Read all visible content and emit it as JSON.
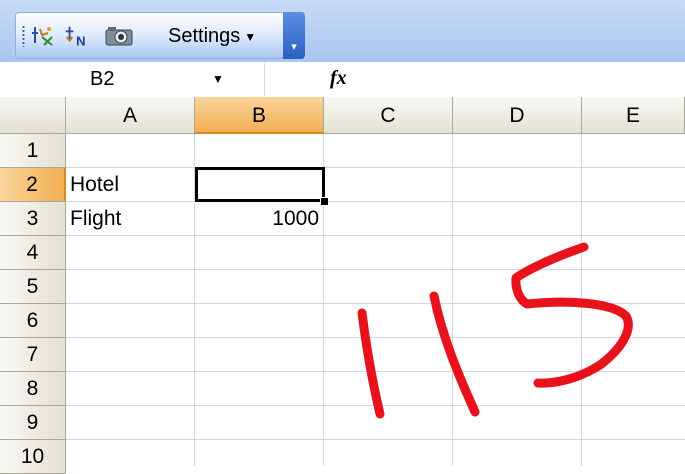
{
  "toolbar": {
    "icons": [
      "insert-function-sparkle-icon",
      "sort-n-icon",
      "camera-icon"
    ],
    "settings_label": "Settings",
    "settings_arrow": "▼",
    "overflow_glyph": "▾"
  },
  "formula_bar": {
    "name_box_value": "B2",
    "name_box_arrow": "▼",
    "fx_label": "fx",
    "formula_value": ""
  },
  "columns": [
    "A",
    "B",
    "C",
    "D",
    "E"
  ],
  "selected_column": "B",
  "rows": [
    "1",
    "2",
    "3",
    "4",
    "5",
    "6",
    "7",
    "8",
    "9",
    "10"
  ],
  "selected_row": "2",
  "cells": {
    "A2": "Hotel",
    "A3": "Flight",
    "B3": "1000"
  },
  "active_cell": "B2",
  "handwriting": {
    "text": "115",
    "color": "#e8121c"
  },
  "colors": {
    "selected_header": "#f2ae52",
    "toolbar_blue": "#a9c6ef",
    "gridline": "#d0d7e5"
  }
}
